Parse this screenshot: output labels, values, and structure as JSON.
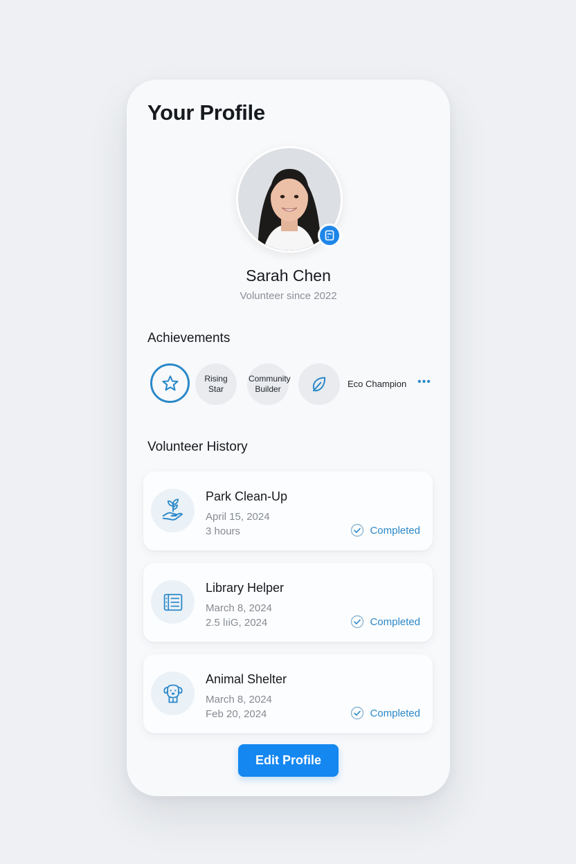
{
  "page": {
    "title": "Your Profile"
  },
  "profile": {
    "name": "Sarah Chen",
    "since": "Volunteer since 2022",
    "badge_icon": "id-card-icon"
  },
  "achievements": {
    "title": "Achievements",
    "items": [
      {
        "label": "",
        "icon": "star-icon",
        "active": true
      },
      {
        "label": "Rising Star",
        "icon": "",
        "active": false
      },
      {
        "label": "Community Builder",
        "icon": "",
        "active": false
      },
      {
        "label": "",
        "icon": "leaf-icon",
        "active": false
      }
    ],
    "eco_label": "Eco Champion",
    "more": "•••"
  },
  "history": {
    "title": "Volunteer History",
    "items": [
      {
        "title": "Park Clean-Up",
        "date": "April 15, 2024",
        "duration": "3 hours",
        "status": "Completed",
        "icon": "hand-plant-icon"
      },
      {
        "title": "Library Helper",
        "date": "March 8, 2024",
        "duration": "2.5 lıiG, 2024",
        "status": "Completed",
        "icon": "book-list-icon"
      },
      {
        "title": "Animal Shelter",
        "date": "March 8, 2024",
        "duration": "Feb 20, 2024",
        "status": "Completed",
        "icon": "dog-icon"
      }
    ]
  },
  "actions": {
    "edit_label": "Edit Profile"
  },
  "colors": {
    "accent": "#1487f0",
    "status": "#2a88c8",
    "background": "#eef0f3",
    "card": "#f8f9fb"
  }
}
